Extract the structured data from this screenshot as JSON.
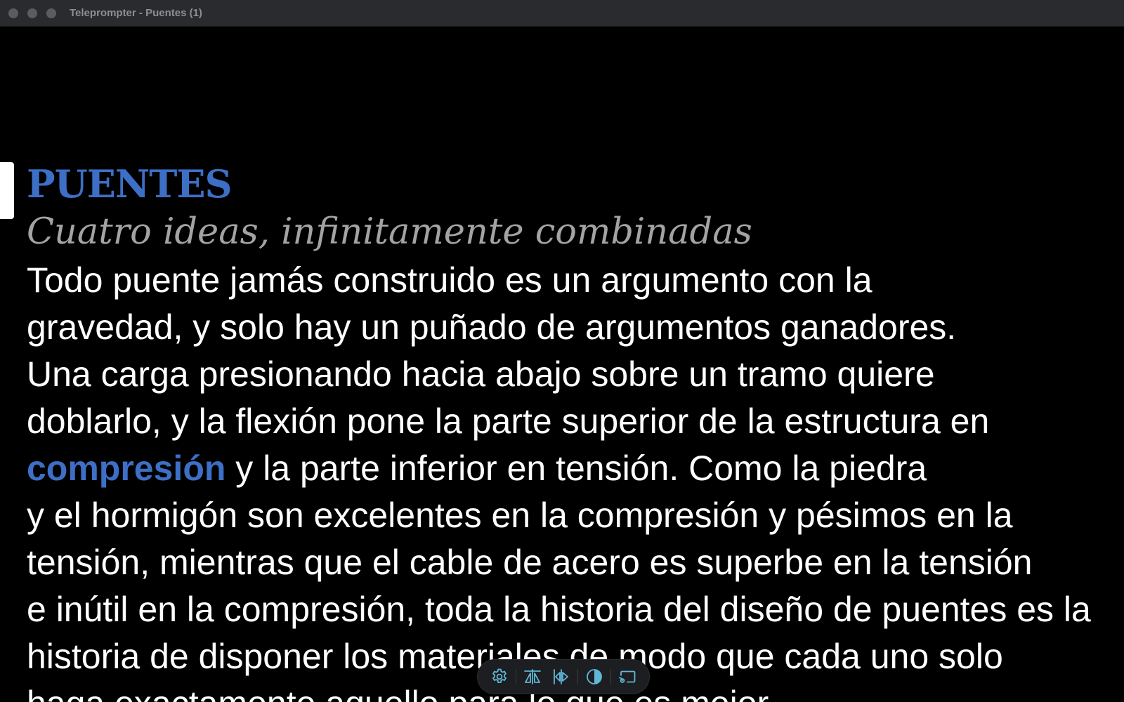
{
  "window": {
    "title": "Teleprompter - Puentes (1)"
  },
  "script": {
    "title": "PUENTES",
    "subtitle": "Cuatro ideas, infinitamente combinadas",
    "body_lines": [
      "Todo puente jamás construido es un argumento con la",
      "gravedad, y solo hay un puñado de argumentos ganadores.",
      "Una carga presionando hacia abajo sobre un tramo quiere",
      "doblarlo, y la flexión pone la parte superior de la estructura en"
    ],
    "highlight_word": "compresión",
    "line5_rest": " y la parte inferior en tensión. Como la piedra",
    "body_lines_after": [
      "y el hormigón son excelentes en la compresión y pésimos en la",
      "tensión, mientras que el cable de acero es superbe en la tensión",
      "e inútil en la compresión, toda la historia del diseño de puentes es la",
      "historia de disponer los materiales de modo que cada uno solo",
      "haga exactamente aquello para lo que es mejor."
    ]
  },
  "toolbar": {
    "buttons": [
      {
        "icon": "gear-icon"
      },
      {
        "icon": "mirror-horizontal-icon"
      },
      {
        "icon": "mirror-vertical-icon"
      },
      {
        "icon": "contrast-icon"
      },
      {
        "icon": "cast-display-icon"
      }
    ]
  },
  "colors": {
    "accent": "#3d6fc6",
    "subtitle": "#a3a3a3",
    "text": "#ffffff",
    "background": "#000000",
    "toolbar_icon": "#5fb8d6"
  }
}
